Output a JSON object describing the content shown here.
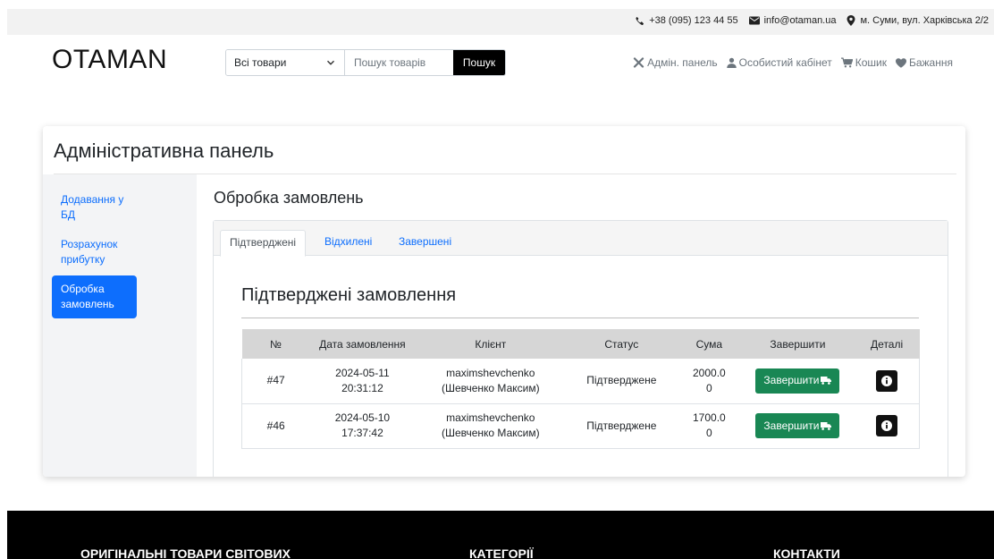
{
  "topbar": {
    "phone": "+38 (095) 123 44 55",
    "email": "info@otaman.ua",
    "address": "м. Суми, вул. Харківська 2/2"
  },
  "header": {
    "logo": "OTAMAN",
    "category_selected": "Всі товари",
    "search_placeholder": "Пошук товарів",
    "search_button": "Пошук",
    "nav": {
      "admin": "Адмін. панель",
      "account": "Особистий кабінет",
      "cart": "Кошик",
      "wishlist": "Бажання"
    }
  },
  "admin": {
    "title": "Адміністративна панель",
    "sidebar": [
      {
        "label": "Додавання у БД"
      },
      {
        "label": "Розрахунок прибутку"
      },
      {
        "label": "Обробка замовлень"
      }
    ],
    "section_title": "Обробка замовлень",
    "tabs": [
      "Підтверджені",
      "Відхилені",
      "Завершені"
    ],
    "subsection_title": "Підтверджені замовлення",
    "table": {
      "headers": [
        "№",
        "Дата замовлення",
        "Клієнт",
        "Статус",
        "Сума",
        "Завершити",
        "Деталі"
      ],
      "rows": [
        {
          "id": "#47",
          "date": "2024-05-11",
          "time": "20:31:12",
          "login": "maximshevchenko",
          "name": "(Шевченко Максим)",
          "status": "Підтверджене",
          "sum_a": "2000.0",
          "sum_b": "0",
          "finish": "Завершити"
        },
        {
          "id": "#46",
          "date": "2024-05-10",
          "time": "17:37:42",
          "login": "maximshevchenko",
          "name": "(Шевченко Максим)",
          "status": "Підтверджене",
          "sum_a": "1700.0",
          "sum_b": "0",
          "finish": "Завершити"
        }
      ]
    }
  },
  "footer": {
    "col1": "ОРИГІНАЛЬНІ ТОВАРИ СВІТОВИХ",
    "col2": "КАТЕГОРІЇ",
    "col3": "КОНТАКТИ"
  },
  "icons": {
    "phone": "phone-icon",
    "email": "envelope-icon",
    "address": "map-pin-icon",
    "admin": "tools-icon",
    "account": "user-icon",
    "cart": "cart-icon",
    "wishlist": "heart-icon",
    "finish": "truck-icon",
    "details": "info-icon"
  },
  "colors": {
    "primary": "#0d6efd",
    "success": "#198754",
    "footer_bg": "#000000"
  }
}
